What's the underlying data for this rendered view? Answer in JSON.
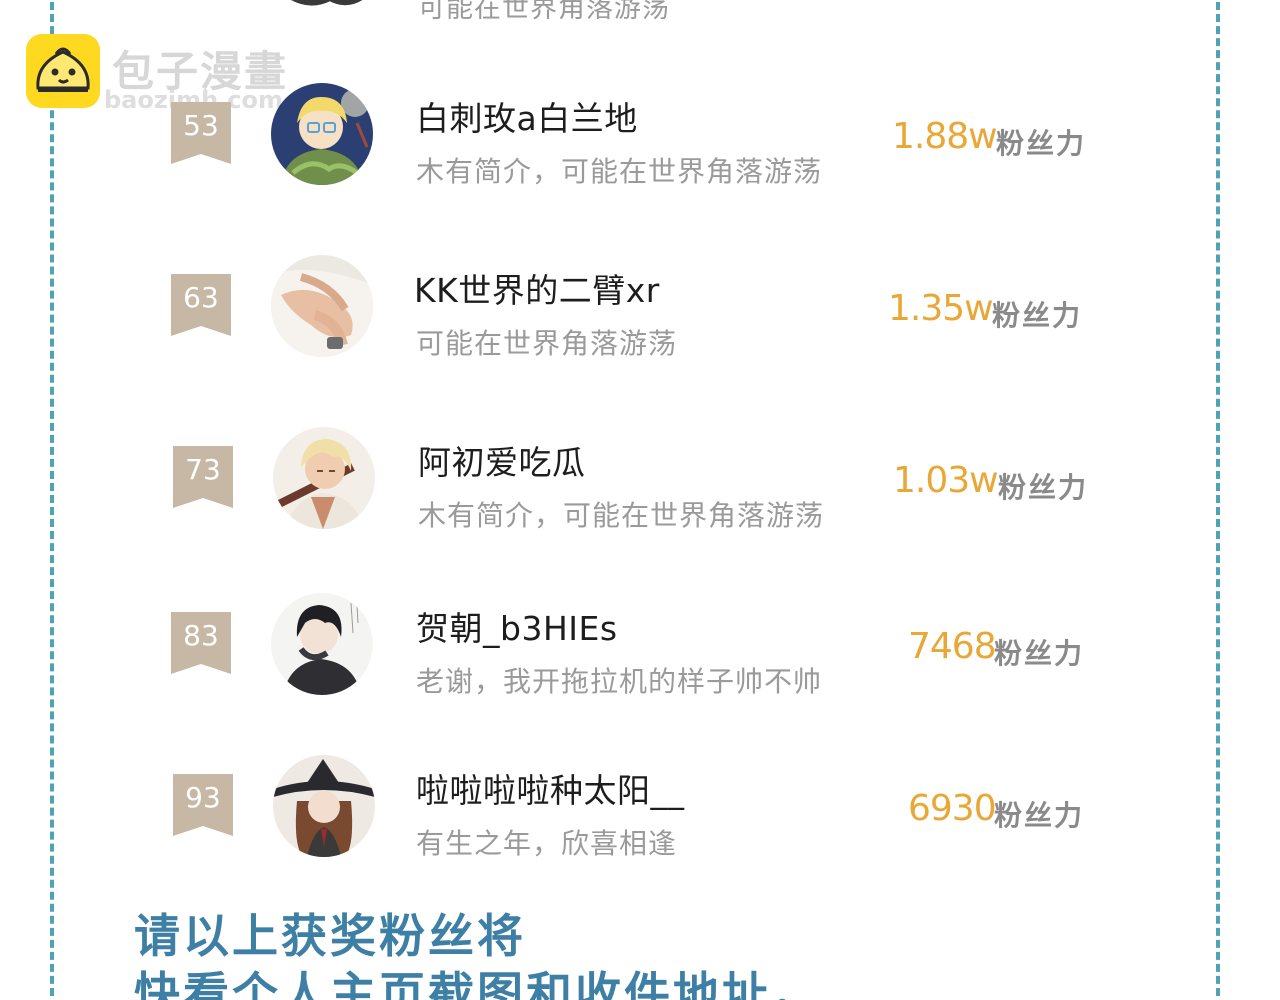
{
  "watermark": {
    "title": "包子漫畫",
    "url": "baozimh.com"
  },
  "top_fragment": {
    "bio": "可能在世界角落游荡"
  },
  "fan_label": "粉丝力",
  "entries": [
    {
      "rank": "53",
      "name": "白刺玫a白兰地",
      "bio": "木有简介，可能在世界角落游荡",
      "fans": "1.88w"
    },
    {
      "rank": "63",
      "name": "KK世界的二臂xr",
      "bio": "可能在世界角落游荡",
      "fans": "1.35w"
    },
    {
      "rank": "73",
      "name": "阿初爱吃瓜",
      "bio": "木有简介，可能在世界角落游荡",
      "fans": "1.03w"
    },
    {
      "rank": "83",
      "name": "贺朝_b3HIEs",
      "bio": "老谢，我开拖拉机的样子帅不帅",
      "fans": "7468"
    },
    {
      "rank": "93",
      "name": "啦啦啦啦种太阳__",
      "bio": "有生之年，欣喜相逢",
      "fans": "6930"
    }
  ],
  "footer": {
    "line1": "请以上获奖粉丝将",
    "line2": "快看个人主页截图和收件地址，"
  },
  "colors": {
    "border": "#4fa3b3",
    "badge": "#c6b8a5",
    "fans": "#e8a736",
    "footer": "#3e7fa6",
    "watermark_logo": "#ffd91f"
  }
}
